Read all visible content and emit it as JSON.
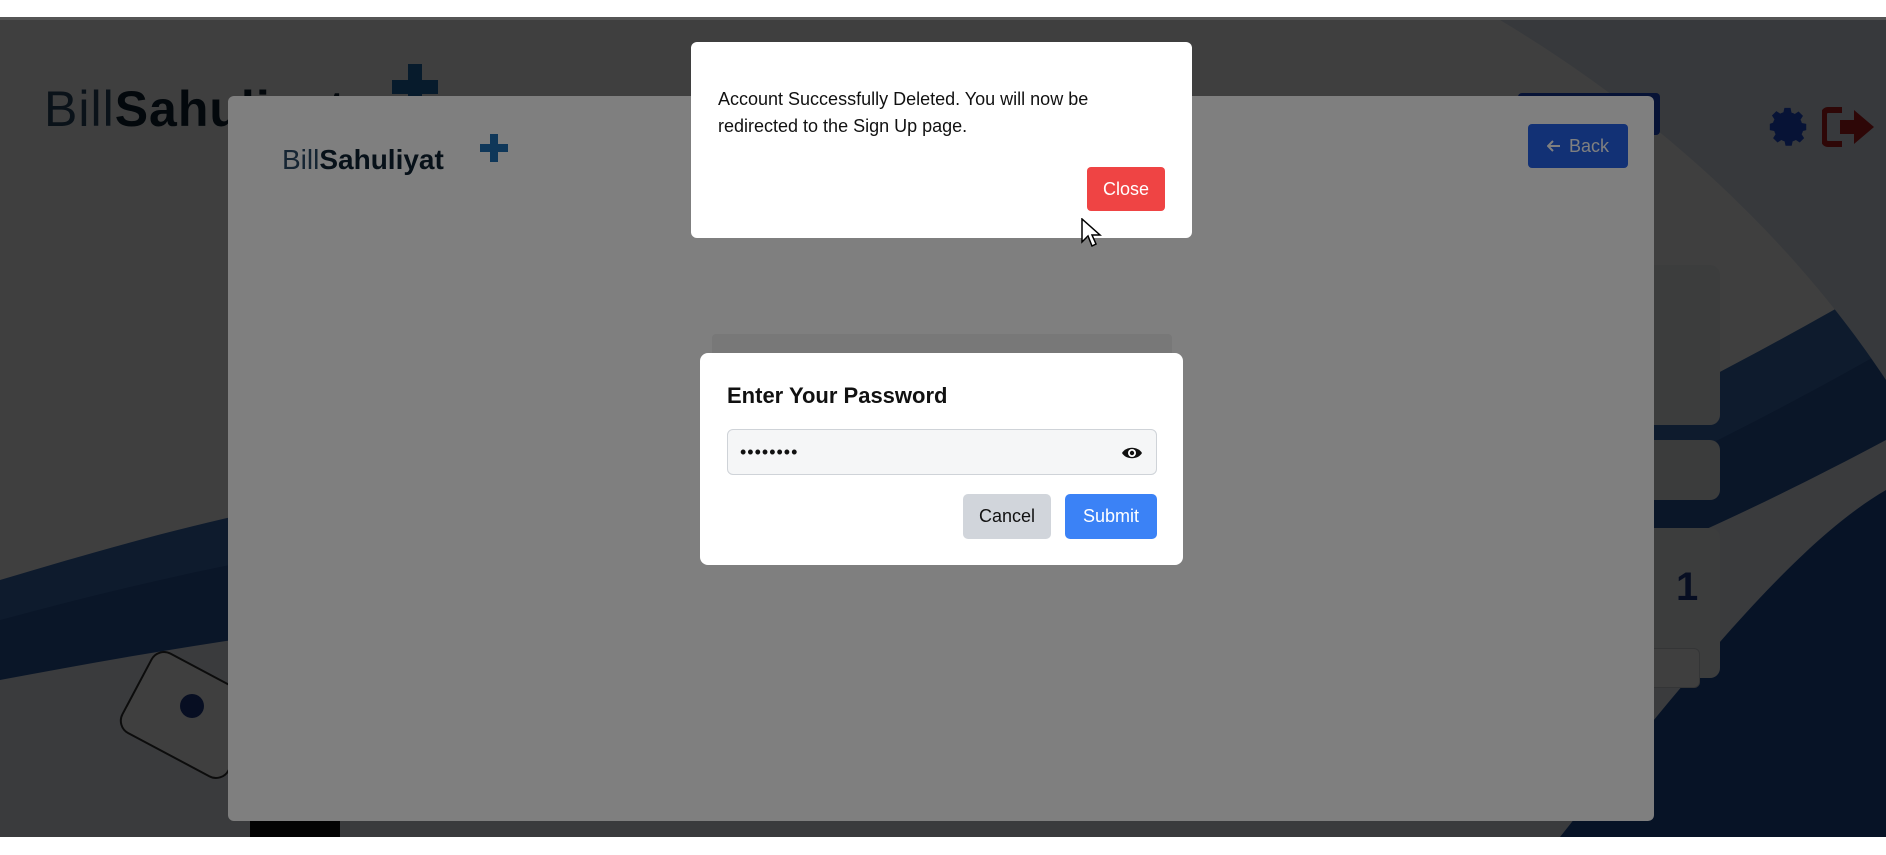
{
  "page": {
    "logo_light": "Bill",
    "logo_bold": "Sahuliyat",
    "side_number": "1"
  },
  "profile_modal": {
    "logo_light": "Bill",
    "logo_bold": "Sahuliyat",
    "back_label": "Back",
    "back_icon": "arrow-left-icon"
  },
  "password_modal": {
    "title": "Enter Your Password",
    "password_value": "••••••••",
    "cancel_label": "Cancel",
    "submit_label": "Submit",
    "toggle_icon": "eye-icon"
  },
  "success_dialog": {
    "message": "Account Successfully Deleted. You will now be redirected to the Sign Up page.",
    "close_label": "Close"
  },
  "colors": {
    "primary_blue": "#2563eb",
    "submit_blue": "#3b82f6",
    "close_red": "#ef4444",
    "cancel_gray": "#d1d5db",
    "logout_red": "#b91c1c"
  }
}
